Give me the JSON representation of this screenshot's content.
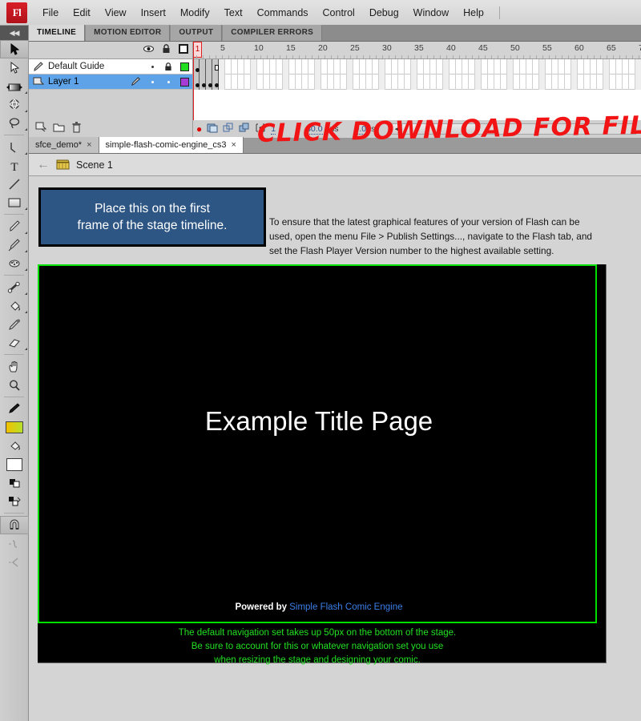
{
  "app": {
    "logo": "Fl"
  },
  "menubar": {
    "items": [
      "File",
      "Edit",
      "View",
      "Insert",
      "Modify",
      "Text",
      "Commands",
      "Control",
      "Debug",
      "Window",
      "Help"
    ]
  },
  "toolbar": {
    "tools": [
      {
        "name": "selection-tool",
        "label": "Selection"
      },
      {
        "name": "subselection-tool",
        "label": "Subselection"
      },
      {
        "name": "free-transform-tool",
        "label": "Free Transform"
      },
      {
        "name": "3d-rotation-tool",
        "label": "3D Rotation"
      },
      {
        "name": "lasso-tool",
        "label": "Lasso"
      },
      {
        "name": "pen-tool",
        "label": "Pen"
      },
      {
        "name": "text-tool",
        "label": "Text"
      },
      {
        "name": "line-tool",
        "label": "Line"
      },
      {
        "name": "rectangle-tool",
        "label": "Rectangle"
      },
      {
        "name": "pencil-tool",
        "label": "Pencil"
      },
      {
        "name": "brush-tool",
        "label": "Brush"
      },
      {
        "name": "spray-brush-tool",
        "label": "Spray Brush"
      },
      {
        "name": "bone-tool",
        "label": "Bone"
      },
      {
        "name": "paint-bucket-tool",
        "label": "Paint Bucket"
      },
      {
        "name": "eyedropper-tool",
        "label": "Eyedropper"
      },
      {
        "name": "eraser-tool",
        "label": "Eraser"
      },
      {
        "name": "hand-tool",
        "label": "Hand"
      },
      {
        "name": "zoom-tool",
        "label": "Zoom"
      }
    ],
    "colors": {
      "stroke": "#1a1a1a",
      "fill_gradient_start": "#f3c000",
      "fill_gradient_end": "#b6e02a",
      "fill_swatch": "#ffffff"
    },
    "options": [
      {
        "name": "snap-to-objects-toggle",
        "label": "Snap to Objects",
        "active": true
      },
      {
        "name": "smooth-option",
        "label": "Smooth"
      },
      {
        "name": "straighten-option",
        "label": "Straighten"
      }
    ]
  },
  "panel_tabs": [
    {
      "label": "TIMELINE",
      "active": true
    },
    {
      "label": "MOTION EDITOR",
      "active": false
    },
    {
      "label": "OUTPUT",
      "active": false
    },
    {
      "label": "COMPILER ERRORS",
      "active": false
    }
  ],
  "timeline": {
    "column_icons": [
      "eye-icon",
      "lock-icon",
      "outline-icon"
    ],
    "layers": [
      {
        "name": "Default Guide",
        "icon": "guide-layer-icon",
        "selected": false,
        "visible_dot": "dot",
        "lock": "lock-icon",
        "color": "#22dd22",
        "keyframes": [
          1
        ],
        "hollow_frame": 4,
        "span_end": 4
      },
      {
        "name": "Layer 1",
        "icon": "layer-icon",
        "selected": true,
        "visible_dot": "dot-light",
        "lock": "dot-light",
        "color": "#a63bd6",
        "keyframes": [
          1,
          2,
          3,
          4
        ],
        "span_end": 4,
        "editable_icon": "pencil-icon"
      }
    ],
    "layer_buttons": [
      {
        "name": "new-layer-button",
        "label": "New Layer"
      },
      {
        "name": "new-folder-button",
        "label": "New Folder"
      },
      {
        "name": "delete-layer-button",
        "label": "Delete"
      }
    ],
    "ruler_labels": [
      "1",
      "5",
      "10",
      "15",
      "20",
      "25",
      "30",
      "35",
      "40",
      "45",
      "50",
      "55",
      "60",
      "65",
      "7"
    ],
    "playhead_frame": "1",
    "status": {
      "current_frame": "1",
      "fps": "30.0",
      "fps_unit": "fps",
      "elapsed": "0.0",
      "elapsed_unit": "s"
    },
    "controls": [
      {
        "name": "center-frame-button",
        "label": "Center Frame"
      },
      {
        "name": "onion-skin-button",
        "label": "Onion Skin"
      },
      {
        "name": "onion-skin-outlines-button",
        "label": "Onion Skin Outlines"
      },
      {
        "name": "edit-multiple-frames-button",
        "label": "Edit Multiple Frames"
      },
      {
        "name": "modify-onion-markers-button",
        "label": "Modify Onion Markers"
      }
    ],
    "annotation": {
      "text": "CLICK DOWNLOAD FOR FILES",
      "icon": "pointing-hand-icon",
      "color": "#f21414"
    }
  },
  "document_tabs": [
    {
      "label": "sfce_demo*",
      "active": false,
      "close": "×"
    },
    {
      "label": "simple-flash-comic-engine_cs3",
      "active": true,
      "close": "×"
    }
  ],
  "breadcrumb": {
    "back_icon": "back-arrow-icon",
    "scene_icon": "scene-clapboard-icon",
    "scene_name": "Scene 1"
  },
  "workspace": {
    "note_box": {
      "line1": "Place this on the first",
      "line2": "frame of the stage timeline.",
      "bg": "#2d5684",
      "text_color": "#ffffff"
    },
    "note_text": "To ensure that the latest graphical features of your version of Flash can be used, open the menu File > Publish Settings..., navigate to the Flash tab, and set the Flash Player Version number to the highest available setting.",
    "stage": {
      "border_color": "#00e000",
      "background": "#000000",
      "title": "Example Title Page",
      "powered_prefix": "Powered by ",
      "powered_link": "Simple Flash Comic Engine",
      "link_color": "#3b7fe8",
      "green_note": [
        "The default navigation set takes up 50px on the bottom of the stage.",
        "Be sure to account for this or whatever navigation set you use",
        "when resizing the stage and designing your comic."
      ],
      "green_note_color": "#23e023"
    }
  }
}
